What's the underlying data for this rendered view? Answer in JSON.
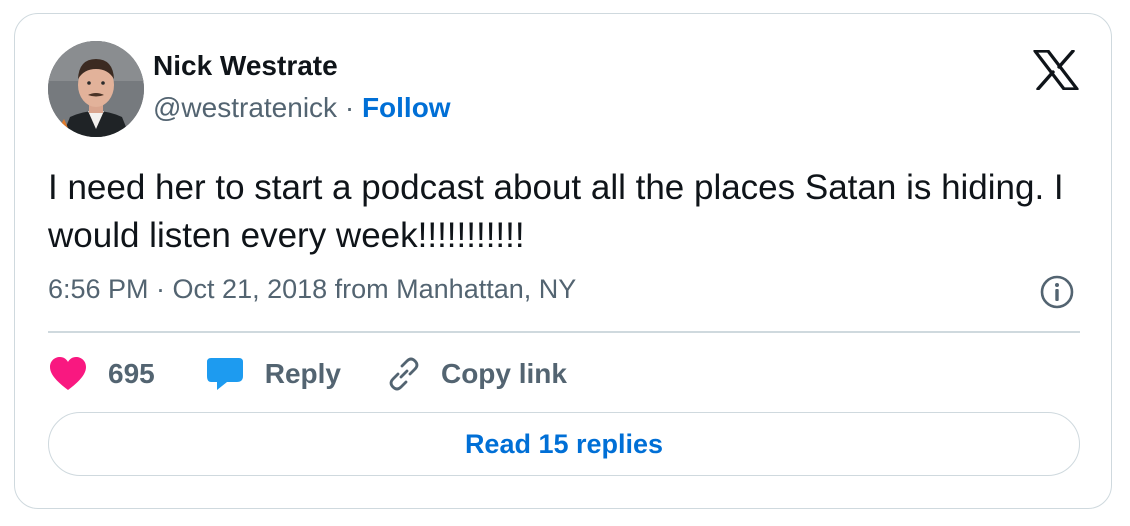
{
  "author": {
    "name": "Nick Westrate",
    "handle": "@westratenick",
    "separator": "·",
    "follow_label": "Follow"
  },
  "tweet": {
    "text": "I need her to start a podcast about all the places Satan is hiding. I would listen every week!!!!!!!!!!!",
    "timestamp": "6:56 PM · Oct 21, 2018 from Manhattan, NY"
  },
  "actions": {
    "like_count": "695",
    "reply_label": "Reply",
    "copy_link_label": "Copy link"
  },
  "read_replies_label": "Read 15 replies",
  "colors": {
    "like": "#f91880",
    "reply": "#1d9bf0",
    "link": "#006fd6",
    "secondary_text": "#536471",
    "border": "#cfd9de"
  },
  "icons": {
    "platform": "x-logo-icon",
    "info": "info-icon",
    "like": "heart-icon",
    "reply": "speech-bubble-icon",
    "copy": "link-icon"
  }
}
